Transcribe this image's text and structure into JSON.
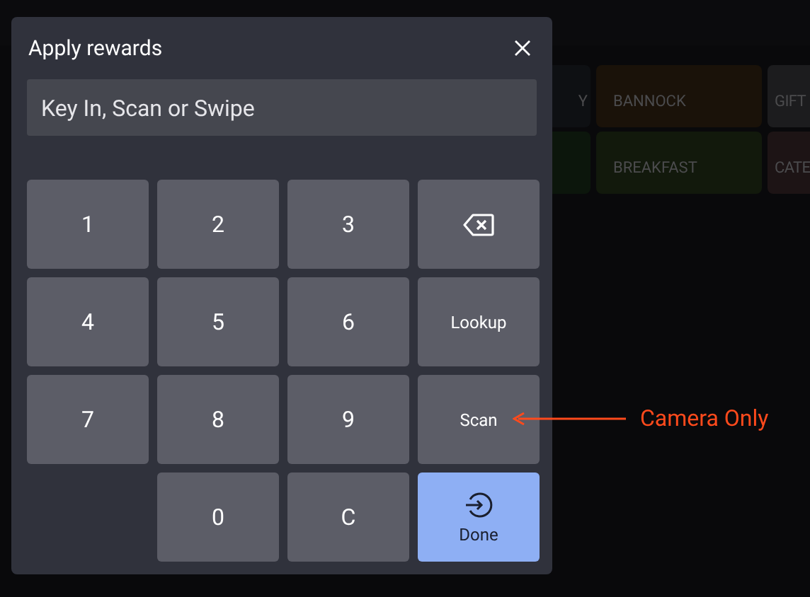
{
  "background_tiles": [
    {
      "label": "Y",
      "color": "#0e1013"
    },
    {
      "label": "BANNOCK",
      "color": "#1a1209"
    },
    {
      "label": "GIFT",
      "color": "#1c1c1e"
    },
    {
      "color": "#0c160c"
    },
    {
      "label": "BREAKFAST",
      "color": "#12190c"
    },
    {
      "label": "CATE",
      "color": "#1d1415"
    }
  ],
  "dialog": {
    "title": "Apply rewards",
    "input": {
      "placeholder": "Key In, Scan or Swipe"
    },
    "keys": [
      {
        "kind": "digit",
        "label": "1"
      },
      {
        "kind": "digit",
        "label": "2"
      },
      {
        "kind": "digit",
        "label": "3"
      },
      {
        "kind": "backspace"
      },
      {
        "kind": "digit",
        "label": "4"
      },
      {
        "kind": "digit",
        "label": "5"
      },
      {
        "kind": "digit",
        "label": "6"
      },
      {
        "kind": "action",
        "label": "Lookup"
      },
      {
        "kind": "digit",
        "label": "7"
      },
      {
        "kind": "digit",
        "label": "8"
      },
      {
        "kind": "digit",
        "label": "9"
      },
      {
        "kind": "action",
        "label": "Scan"
      },
      {
        "kind": "blank"
      },
      {
        "kind": "digit",
        "label": "0"
      },
      {
        "kind": "digit",
        "label": "C"
      },
      {
        "kind": "done",
        "label": "Done"
      }
    ]
  },
  "annotation": {
    "text": "Camera Only"
  }
}
